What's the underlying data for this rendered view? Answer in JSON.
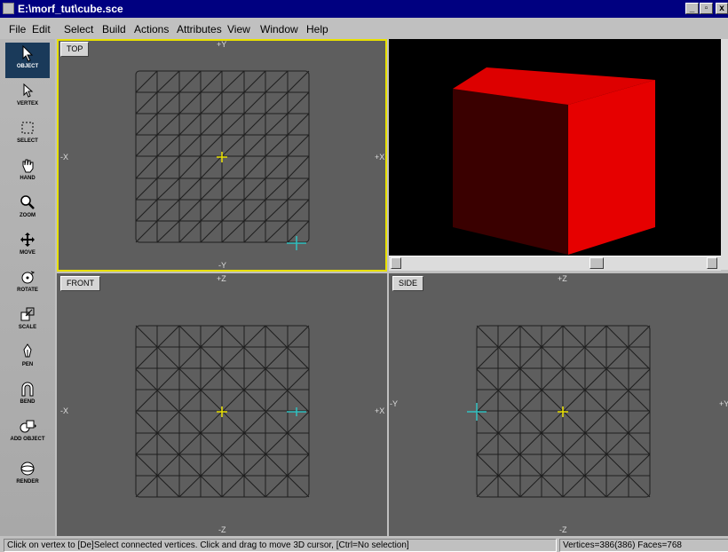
{
  "window": {
    "title": "E:\\morf_tut\\cube.sce",
    "minimize_glyph": "_",
    "maximize_glyph": "▫",
    "close_glyph": "x"
  },
  "menu": [
    "File",
    "Edit",
    "Select",
    "Build",
    "Actions",
    "Attributes",
    "View",
    "Window",
    "Help"
  ],
  "tools": [
    {
      "label": "OBJECT",
      "icon": "arrow-cursor-icon",
      "active": true
    },
    {
      "label": "VERTEX",
      "icon": "vertex-arrow-icon"
    },
    {
      "label": "SELECT",
      "icon": "marquee-select-icon"
    },
    {
      "label": "HAND",
      "icon": "hand-icon"
    },
    {
      "label": "ZOOM",
      "icon": "magnifier-icon"
    },
    {
      "label": "MOVE",
      "icon": "move-arrows-icon"
    },
    {
      "label": "ROTATE",
      "icon": "rotate-icon"
    },
    {
      "label": "SCALE",
      "icon": "scale-icon"
    },
    {
      "label": "PEN",
      "icon": "pen-icon"
    },
    {
      "label": "BEND",
      "icon": "bend-icon"
    },
    {
      "label": "ADD OBJECT",
      "icon": "add-object-icon"
    },
    {
      "label": "RENDER",
      "icon": "render-sphere-icon"
    }
  ],
  "viewports": {
    "top": {
      "label": "TOP",
      "axis_top": "+Y",
      "axis_bottom": "-Y",
      "axis_left": "-X",
      "axis_right": "+X"
    },
    "front": {
      "label": "FRONT",
      "axis_top": "+Z",
      "axis_bottom": "-Z",
      "axis_left": "-X",
      "axis_right": "+X"
    },
    "side": {
      "label": "SIDE",
      "axis_top": "+Z",
      "axis_bottom": "-Z",
      "axis_left": "-Y",
      "axis_right": "+Y"
    }
  },
  "preview": {
    "cube_color": "#e00000",
    "background": "#000000"
  },
  "status": {
    "message": "Click on vertex to [De]Select connected vertices. Click and drag to move 3D cursor, [Ctrl=No selection]",
    "stats": "Vertices=386(386) Faces=768"
  },
  "colors": {
    "titlebar": "#000080",
    "viewport_bg": "#5e5e5e",
    "active_border": "#e8e000",
    "mesh_line": "#1e1e1e",
    "cursor_yellow": "#e8e000",
    "cursor_cyan": "#30c0c0"
  }
}
